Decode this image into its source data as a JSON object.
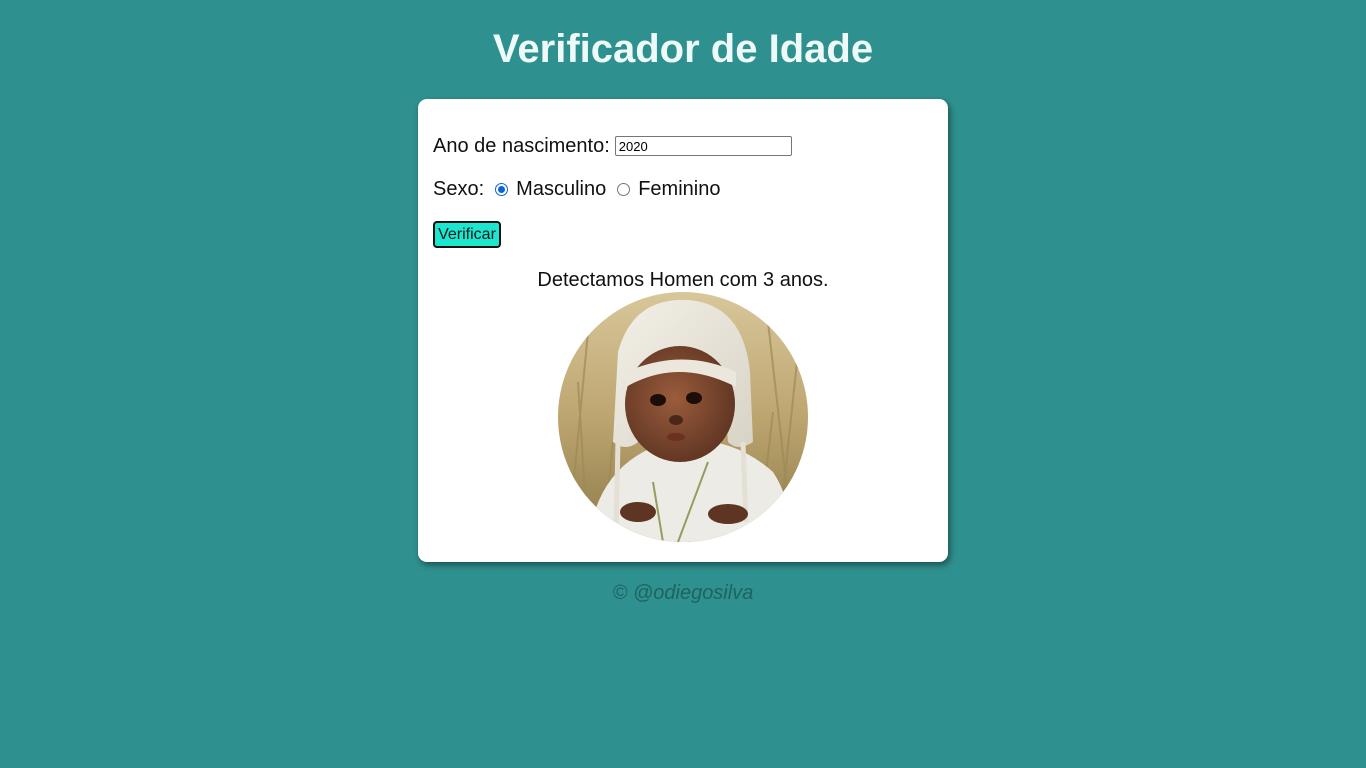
{
  "header": {
    "title": "Verificador de Idade"
  },
  "form": {
    "year_label": "Ano de nascimento:",
    "year_value": "2020",
    "sex_label": "Sexo:",
    "sex_options": [
      {
        "label": "Masculino",
        "selected": true
      },
      {
        "label": "Feminino",
        "selected": false
      }
    ],
    "verify_button": "Verificar"
  },
  "result": {
    "text": "Detectamos Homen com 3 anos.",
    "photo_icon": "baby-photo"
  },
  "footer": {
    "text": "© @odiegosilva"
  },
  "colors": {
    "background": "#2f918f",
    "button": "#1de6cf",
    "radio_accent": "#0a66d8",
    "footer_text": "#1d6360"
  }
}
